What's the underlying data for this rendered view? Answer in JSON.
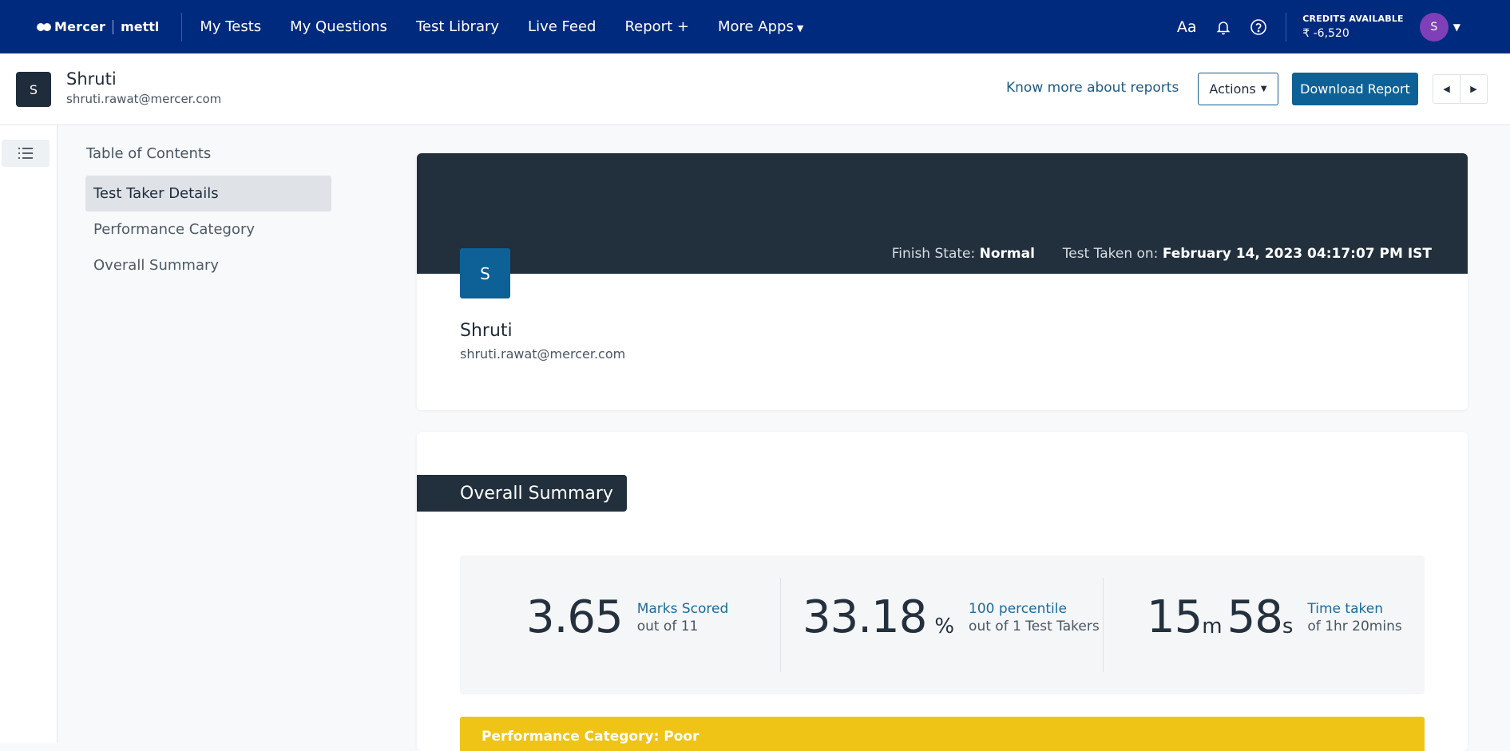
{
  "brand": {
    "mercer": "Mercer",
    "mettl": "mettl"
  },
  "nav": {
    "items": [
      {
        "label": "My Tests"
      },
      {
        "label": "My Questions"
      },
      {
        "label": "Test Library"
      },
      {
        "label": "Live Feed"
      },
      {
        "label": "Report +"
      },
      {
        "label": "More Apps"
      }
    ],
    "font_icon_label": "Aa",
    "credits_label": "CREDITS AVAILABLE",
    "credits_value": "₹ -6,520",
    "avatar_initial": "S"
  },
  "header": {
    "initial": "S",
    "name": "Shruti",
    "email": "shruti.rawat@mercer.com",
    "know_more": "Know more about reports",
    "actions_label": "Actions",
    "download_label": "Download Report"
  },
  "toc": {
    "title": "Table of Contents",
    "items": [
      {
        "label": "Test Taker Details",
        "active": true
      },
      {
        "label": "Performance Category",
        "active": false
      },
      {
        "label": "Overall Summary",
        "active": false
      }
    ]
  },
  "taker": {
    "finish_label": "Finish State:",
    "finish_value": "Normal",
    "taken_label": "Test Taken on:",
    "taken_value": "February 14, 2023 04:17:07 PM IST",
    "initial": "S",
    "name": "Shruti",
    "email": "shruti.rawat@mercer.com"
  },
  "summary": {
    "title": "Overall Summary",
    "marks": {
      "value": "3.65",
      "label": "Marks Scored",
      "sub": "out of 11"
    },
    "percent": {
      "value": "33.18",
      "unit": "%",
      "label": "100 percentile",
      "sub": "out of 1 Test Takers"
    },
    "time": {
      "minutes": "15",
      "minutes_unit": "m",
      "seconds": "58",
      "seconds_unit": "s",
      "label": "Time taken",
      "sub": "of 1hr 20mins"
    },
    "performance": "Performance Category: Poor"
  },
  "colors": {
    "nav_bg": "#002a7e",
    "banner_bg": "#22303d",
    "primary": "#0d6196",
    "performance_poor": "#f0c417",
    "avatar": "#7e3fb8"
  }
}
